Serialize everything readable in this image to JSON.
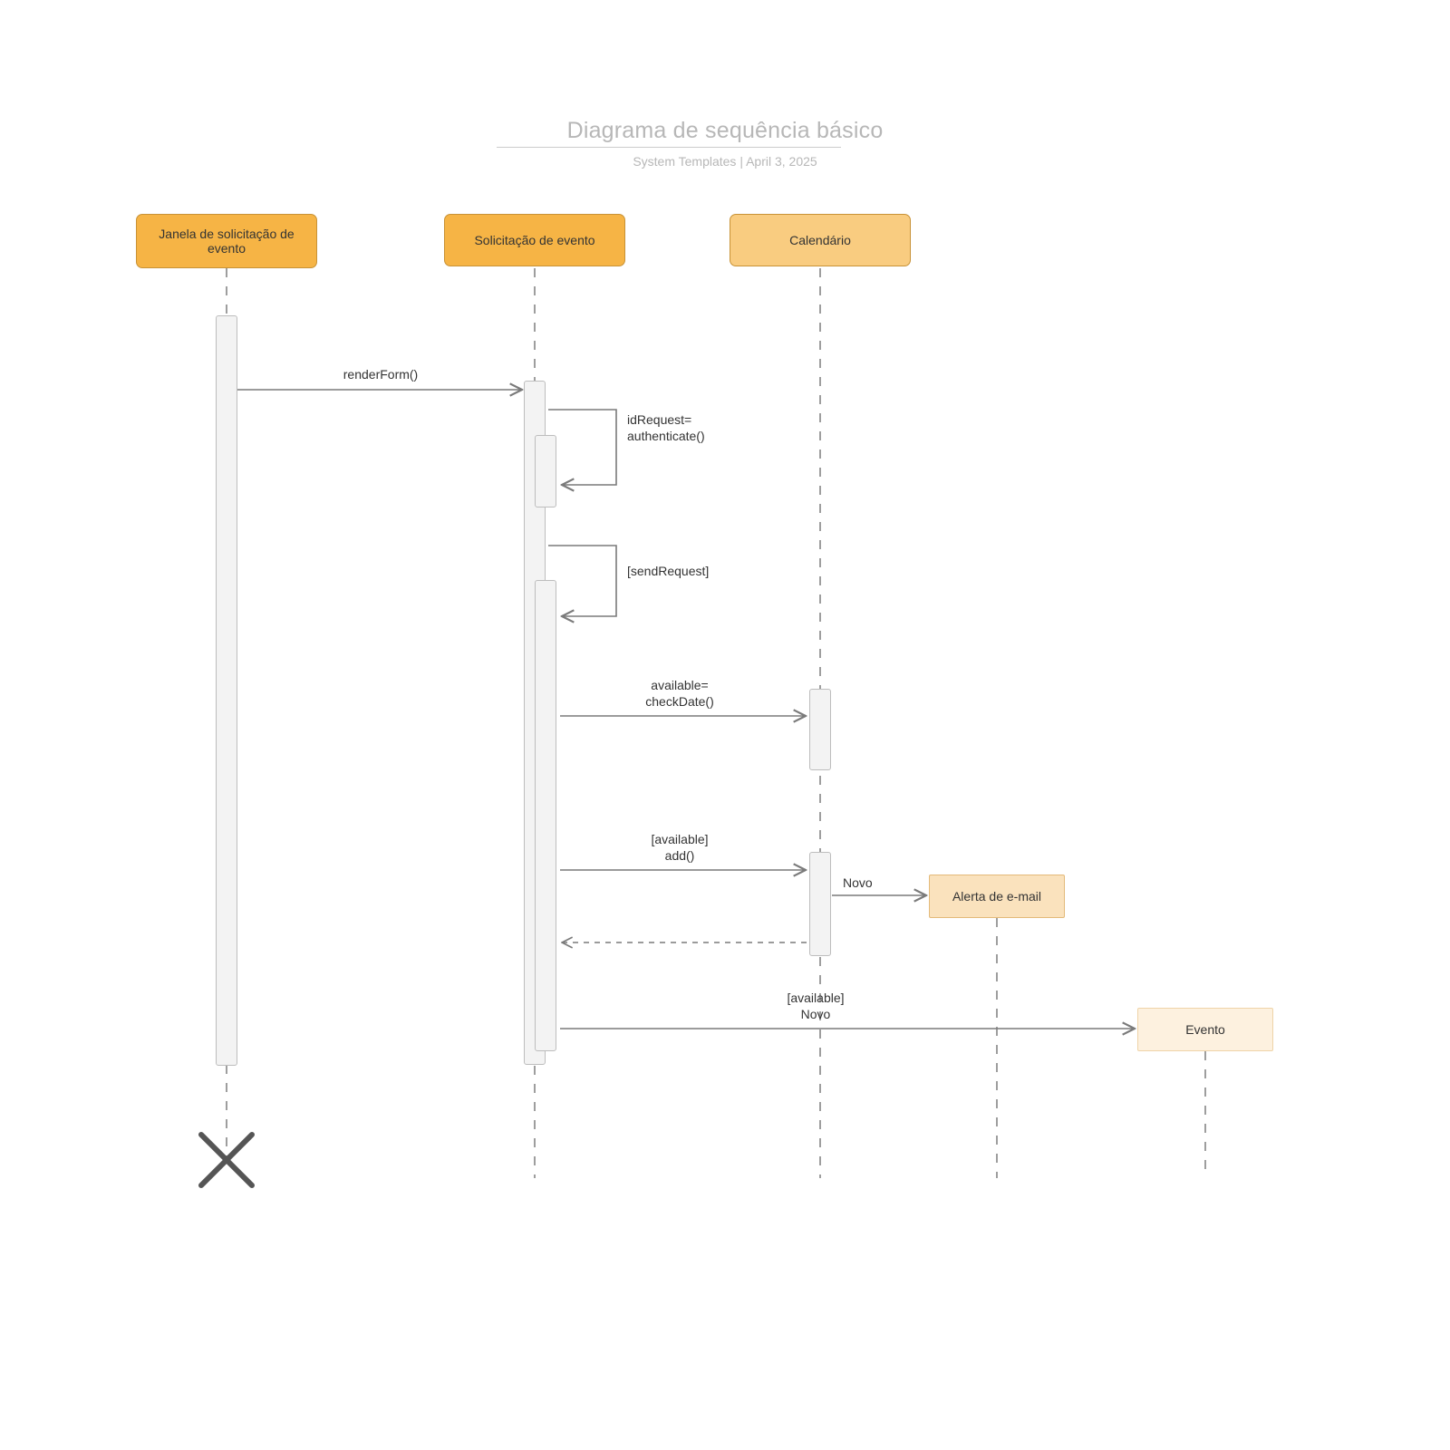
{
  "header": {
    "title": "Diagrama de sequência básico",
    "subtitle": "System Templates  |  April 3, 2025"
  },
  "participants": {
    "window": {
      "label": "Janela de solicitação de\nevento"
    },
    "request": {
      "label": "Solicitação de evento"
    },
    "calendar": {
      "label": "Calendário"
    }
  },
  "objects": {
    "email": {
      "label": "Alerta de e-mail"
    },
    "event": {
      "label": "Evento"
    }
  },
  "messages": {
    "renderForm": "renderForm()",
    "authenticate": "idRequest=\nauthenticate()",
    "sendRequest": "[sendRequest]",
    "checkDate": "available=\ncheckDate()",
    "addAvailable": "[available]\nadd()",
    "novo": "Novo",
    "availableNovo": "[available]\nNovo"
  },
  "chart_data": {
    "type": "uml-sequence",
    "title": "Diagrama de sequência básico",
    "participants": [
      {
        "id": "window",
        "label": "Janela de solicitação de evento"
      },
      {
        "id": "request",
        "label": "Solicitação de evento"
      },
      {
        "id": "calendar",
        "label": "Calendário"
      },
      {
        "id": "email",
        "label": "Alerta de e-mail",
        "created": true
      },
      {
        "id": "event",
        "label": "Evento",
        "created": true
      }
    ],
    "destroyed": [
      "window"
    ],
    "messages": [
      {
        "from": "window",
        "to": "request",
        "label": "renderForm()",
        "type": "sync"
      },
      {
        "from": "request",
        "to": "request",
        "label": "idRequest= authenticate()",
        "type": "self"
      },
      {
        "from": "request",
        "to": "request",
        "label": "[sendRequest]",
        "type": "self"
      },
      {
        "from": "request",
        "to": "calendar",
        "label": "available= checkDate()",
        "type": "sync"
      },
      {
        "from": "request",
        "to": "calendar",
        "label": "[available] add()",
        "type": "sync"
      },
      {
        "from": "calendar",
        "to": "email",
        "label": "Novo",
        "type": "create"
      },
      {
        "from": "calendar",
        "to": "request",
        "label": "",
        "type": "return"
      },
      {
        "from": "request",
        "to": "event",
        "label": "[available] Novo",
        "type": "create"
      }
    ]
  }
}
